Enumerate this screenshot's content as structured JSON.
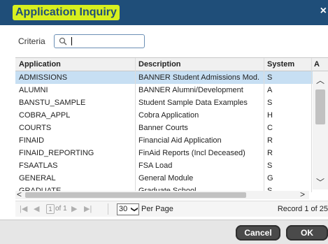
{
  "dialog": {
    "title": "Application Inquiry",
    "close_glyph": "×"
  },
  "criteria": {
    "label": "Criteria",
    "value": ""
  },
  "grid": {
    "columns": [
      "Application",
      "Description",
      "System",
      "A"
    ],
    "rows": [
      {
        "application": "ADMISSIONS",
        "description": "BANNER Student Admissions Mod.",
        "system": "S",
        "selected": true
      },
      {
        "application": "ALUMNI",
        "description": "BANNER Alumni/Development",
        "system": "A"
      },
      {
        "application": "BANSTU_SAMPLE",
        "description": "Student Sample Data Examples",
        "system": "S"
      },
      {
        "application": "COBRA_APPL",
        "description": "Cobra Application",
        "system": "H"
      },
      {
        "application": "COURTS",
        "description": "Banner Courts",
        "system": "C"
      },
      {
        "application": "FINAID",
        "description": "Financial Aid Application",
        "system": "R"
      },
      {
        "application": "FINAID_REPORTING",
        "description": "FinAid Reports (Incl Deceased)",
        "system": "R"
      },
      {
        "application": "FSAATLAS",
        "description": "FSA Load",
        "system": "S"
      },
      {
        "application": "GENERAL",
        "description": "General Module",
        "system": "G"
      },
      {
        "application": "GRADUATE",
        "description": "Graduate School",
        "system": "S"
      }
    ]
  },
  "pager": {
    "page_value": "1",
    "page_of": "of 1",
    "per_page_value": "30",
    "per_page_label": "Per Page",
    "record_text": "Record 1 of 25"
  },
  "buttons": {
    "cancel": "Cancel",
    "ok": "OK"
  },
  "colors": {
    "title_bar": "#1f4e79",
    "title_highlight": "#d7f01e",
    "selected_row": "#c7dff3",
    "button": "#4a4a4a"
  }
}
